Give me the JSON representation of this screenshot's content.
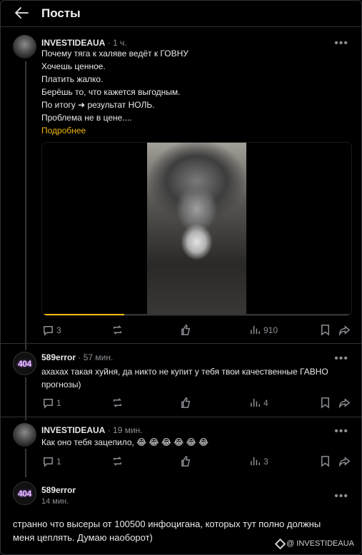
{
  "header": {
    "title": "Посты"
  },
  "posts": [
    {
      "author": "INVESTIDEAUA",
      "time": "· 1 ч.",
      "lines": [
        "Почему тяга к халяве ведёт к ГОВНУ",
        "Хочешь ценное.",
        "Платить жалко.",
        "Берёшь то, что кажется выгодным.",
        "По итогу ➜ результат НОЛЬ.",
        "Проблема не в цене...."
      ],
      "more_label": "Подробнее",
      "video_progress": 0.265,
      "replies": "3",
      "views": "910"
    },
    {
      "author": "589error",
      "time": "· 57 мин.",
      "lines": [
        "ахахах такая хуйня, да никто не купит у тебя твои качественные ГАВНО",
        "прогнозы)"
      ],
      "avatar_text": "404",
      "replies": "1",
      "views": "4"
    },
    {
      "author": "INVESTIDEAUA",
      "time": "· 19 мин.",
      "lines": [
        "Как оно тебя зацепило, 😂 😂 😂 😂 😂 😂"
      ],
      "replies": "1",
      "views": "3"
    }
  ],
  "reply_draft": {
    "author": "589error",
    "time": "14 мин.",
    "avatar_text": "404",
    "lines": [
      "странно что высеры от 100500 инфоцигана, которых тут полно должны",
      "меня цеплять. Думаю наоборот)"
    ]
  },
  "watermark": "@ INVESTIDEAUA",
  "colors": {
    "accent": "#f0b90b",
    "background": "#000000",
    "muted": "#8b8f94"
  }
}
